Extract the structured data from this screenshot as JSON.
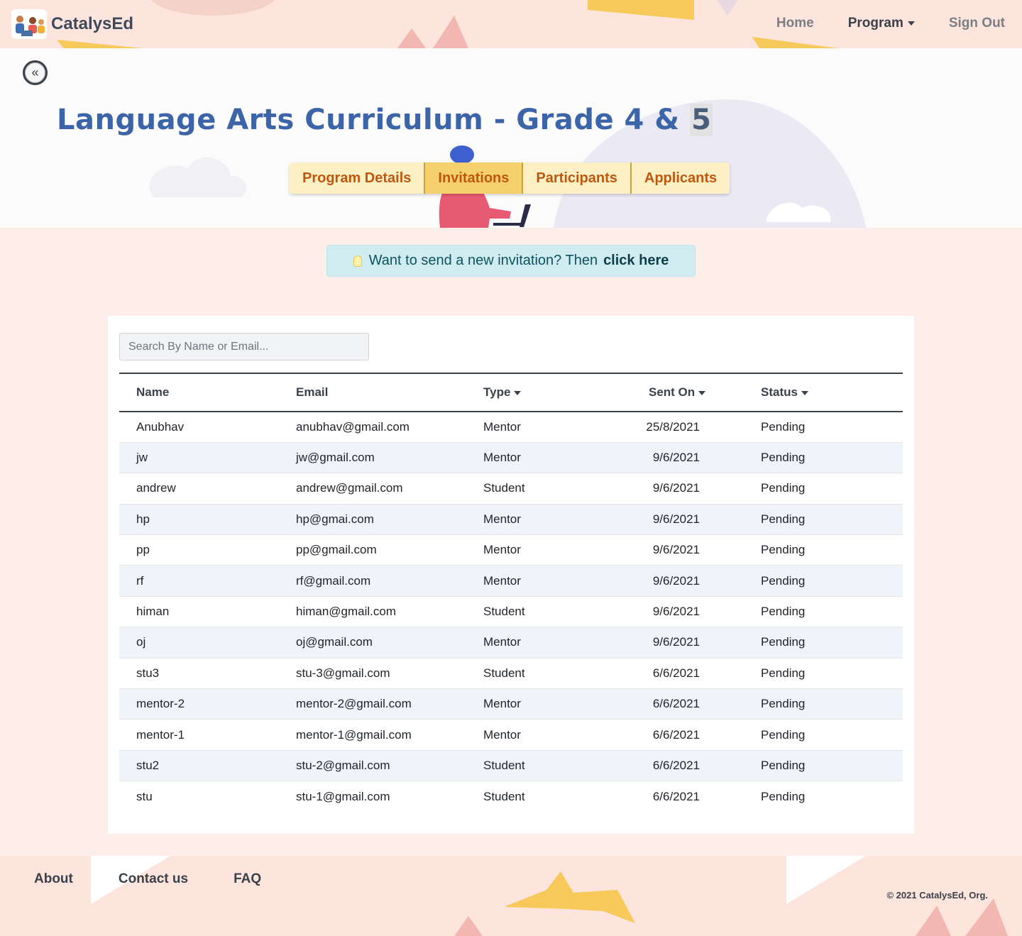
{
  "brand": {
    "name": "CatalysEd"
  },
  "nav": {
    "home": "Home",
    "program": "Program",
    "signout": "Sign Out"
  },
  "page": {
    "back_label": "«",
    "title": "Language Arts Curriculum - Grade 4 & ",
    "title_highlight": "5"
  },
  "tabs": [
    {
      "label": "Program Details"
    },
    {
      "label": "Invitations"
    },
    {
      "label": "Participants"
    },
    {
      "label": "Applicants"
    }
  ],
  "banner": {
    "text": "Want to send a new invitation? Then",
    "link": "click here"
  },
  "search": {
    "placeholder": "Search By Name or Email..."
  },
  "table": {
    "headers": {
      "name": "Name",
      "email": "Email",
      "type": "Type",
      "sent_on": "Sent On",
      "status": "Status"
    },
    "rows": [
      {
        "name": "Anubhav",
        "email": "anubhav@gmail.com",
        "type": "Mentor",
        "sent_on": "25/8/2021",
        "status": "Pending"
      },
      {
        "name": "jw",
        "email": "jw@gmail.com",
        "type": "Mentor",
        "sent_on": "9/6/2021",
        "status": "Pending"
      },
      {
        "name": "andrew",
        "email": "andrew@gmail.com",
        "type": "Student",
        "sent_on": "9/6/2021",
        "status": "Pending"
      },
      {
        "name": "hp",
        "email": "hp@gmai.com",
        "type": "Mentor",
        "sent_on": "9/6/2021",
        "status": "Pending"
      },
      {
        "name": "pp",
        "email": "pp@gmail.com",
        "type": "Mentor",
        "sent_on": "9/6/2021",
        "status": "Pending"
      },
      {
        "name": "rf",
        "email": "rf@gmail.com",
        "type": "Mentor",
        "sent_on": "9/6/2021",
        "status": "Pending"
      },
      {
        "name": "himan",
        "email": "himan@gmail.com",
        "type": "Student",
        "sent_on": "9/6/2021",
        "status": "Pending"
      },
      {
        "name": "oj",
        "email": "oj@gmail.com",
        "type": "Mentor",
        "sent_on": "9/6/2021",
        "status": "Pending"
      },
      {
        "name": "stu3",
        "email": "stu-3@gmail.com",
        "type": "Student",
        "sent_on": "6/6/2021",
        "status": "Pending"
      },
      {
        "name": "mentor-2",
        "email": "mentor-2@gmail.com",
        "type": "Mentor",
        "sent_on": "6/6/2021",
        "status": "Pending"
      },
      {
        "name": "mentor-1",
        "email": "mentor-1@gmail.com",
        "type": "Mentor",
        "sent_on": "6/6/2021",
        "status": "Pending"
      },
      {
        "name": "stu2",
        "email": "stu-2@gmail.com",
        "type": "Student",
        "sent_on": "6/6/2021",
        "status": "Pending"
      },
      {
        "name": "stu",
        "email": "stu-1@gmail.com",
        "type": "Student",
        "sent_on": "6/6/2021",
        "status": "Pending"
      }
    ]
  },
  "footer": {
    "about": "About",
    "contact": "Contact us",
    "faq": "FAQ",
    "copyright": "© 2021 CatalysEd, Org."
  },
  "icons": {
    "back": "double-chevron-left-icon",
    "bulb": "lightbulb-icon",
    "caret": "caret-down-icon"
  },
  "colors": {
    "title": "#3c64a8",
    "tab_text": "#c0570f",
    "tab_bg": "#fdf0c4",
    "tab_active_bg": "#f7d06e",
    "banner_bg": "#d1ecf1",
    "page_bg": "#fdeeea"
  }
}
